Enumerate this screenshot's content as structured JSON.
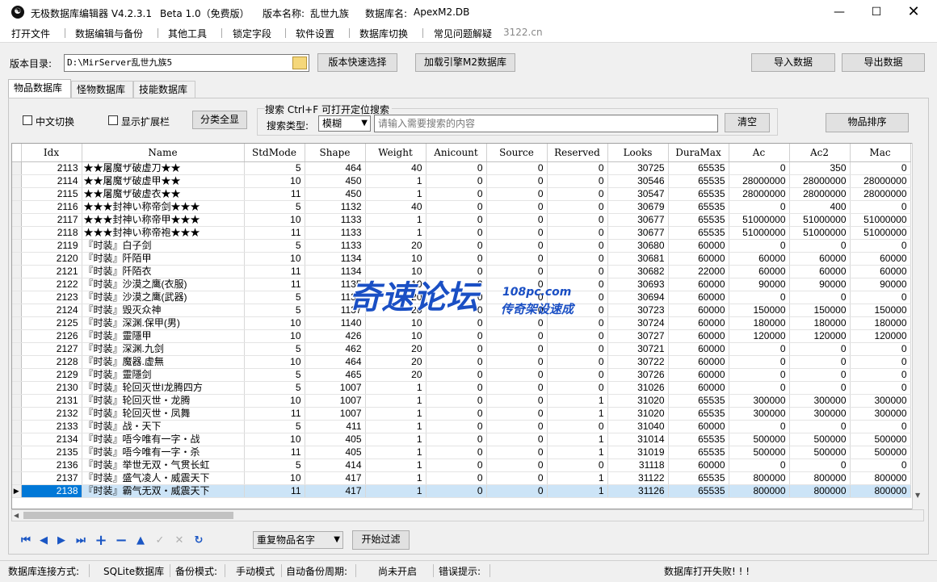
{
  "titlebar": {
    "app_name": "无极数据库编辑器 V4.2.3.1",
    "edition": "Beta 1.0（免费版）",
    "version_label": "版本名称:",
    "version_value": "乱世九族",
    "db_label": "数据库名:",
    "db_value": "ApexM2.DB"
  },
  "menu": [
    "打开文件",
    "数据编辑与备份",
    "其他工具",
    "锁定字段",
    "软件设置",
    "数据库切换",
    "常见问题解疑"
  ],
  "menu_url": "3122.cn",
  "toolbar": {
    "dir_label": "版本目录:",
    "dir_value": "D:\\MirServer乱世九族5",
    "quick_select": "版本快速选择",
    "load_engine": "加载引擎M2数据库",
    "import": "导入数据",
    "export": "导出数据"
  },
  "tabs": [
    "物品数据库",
    "怪物数据库",
    "技能数据库"
  ],
  "filters": {
    "chinese_toggle": "中文切换",
    "show_ext": "显示扩展栏",
    "show_all": "分类全显",
    "search_title": "搜索  Ctrl+F 可打开定位搜索",
    "search_type_label": "搜索类型:",
    "search_type_value": "模糊",
    "search_placeholder": "请输入需要搜索的内容",
    "clear": "清空",
    "sort": "物品排序"
  },
  "grid": {
    "columns": [
      "Idx",
      "Name",
      "StdMode",
      "Shape",
      "Weight",
      "Anicount",
      "Source",
      "Reserved",
      "Looks",
      "DuraMax",
      "Ac",
      "Ac2",
      "Mac"
    ],
    "selected_row": 25,
    "rows": [
      [
        "2113",
        "★★屠魔ザ破虚刀★★",
        "5",
        "464",
        "40",
        "0",
        "0",
        "0",
        "30725",
        "65535",
        "0",
        "350",
        "0"
      ],
      [
        "2114",
        "★★屠魔ザ破虚甲★★",
        "10",
        "450",
        "1",
        "0",
        "0",
        "0",
        "30546",
        "65535",
        "28000000",
        "28000000",
        "28000000"
      ],
      [
        "2115",
        "★★屠魔ザ破虚衣★★",
        "11",
        "450",
        "1",
        "0",
        "0",
        "0",
        "30547",
        "65535",
        "28000000",
        "28000000",
        "28000000"
      ],
      [
        "2116",
        "★★★封神い称帝剑★★★",
        "5",
        "1132",
        "40",
        "0",
        "0",
        "0",
        "30679",
        "65535",
        "0",
        "400",
        "0"
      ],
      [
        "2117",
        "★★★封神い称帝甲★★★",
        "10",
        "1133",
        "1",
        "0",
        "0",
        "0",
        "30677",
        "65535",
        "51000000",
        "51000000",
        "51000000"
      ],
      [
        "2118",
        "★★★封神い称帝袍★★★",
        "11",
        "1133",
        "1",
        "0",
        "0",
        "0",
        "30677",
        "65535",
        "51000000",
        "51000000",
        "51000000"
      ],
      [
        "2119",
        "『时装』白子剑",
        "5",
        "1133",
        "20",
        "0",
        "0",
        "0",
        "30680",
        "60000",
        "0",
        "0",
        "0"
      ],
      [
        "2120",
        "『时装』阡陌甲",
        "10",
        "1134",
        "10",
        "0",
        "0",
        "0",
        "30681",
        "60000",
        "60000",
        "60000",
        "60000"
      ],
      [
        "2121",
        "『时装』阡陌衣",
        "11",
        "1134",
        "10",
        "0",
        "0",
        "0",
        "30682",
        "22000",
        "60000",
        "60000",
        "60000"
      ],
      [
        "2122",
        "『时装』沙漠之鹰(衣服)",
        "11",
        "1135",
        "10",
        "0",
        "0",
        "0",
        "30693",
        "60000",
        "90000",
        "90000",
        "90000"
      ],
      [
        "2123",
        "『时装』沙漠之鹰(武器)",
        "5",
        "1136",
        "20",
        "0",
        "0",
        "0",
        "30694",
        "60000",
        "0",
        "0",
        "0"
      ],
      [
        "2124",
        "『时装』毁灭众神",
        "5",
        "1137",
        "20",
        "0",
        "0",
        "0",
        "30723",
        "60000",
        "150000",
        "150000",
        "150000"
      ],
      [
        "2125",
        "『时装』深渊.保甲(男)",
        "10",
        "1140",
        "10",
        "0",
        "0",
        "0",
        "30724",
        "60000",
        "180000",
        "180000",
        "180000"
      ],
      [
        "2126",
        "『时装』靈隱甲",
        "10",
        "426",
        "10",
        "0",
        "0",
        "0",
        "30727",
        "60000",
        "120000",
        "120000",
        "120000"
      ],
      [
        "2127",
        "『时装』深渊.九剑",
        "5",
        "462",
        "20",
        "0",
        "0",
        "0",
        "30721",
        "60000",
        "0",
        "0",
        "0"
      ],
      [
        "2128",
        "『时装』魔器.虚無",
        "10",
        "464",
        "20",
        "0",
        "0",
        "0",
        "30722",
        "60000",
        "0",
        "0",
        "0"
      ],
      [
        "2129",
        "『时装』靈隱剑",
        "5",
        "465",
        "20",
        "0",
        "0",
        "0",
        "30726",
        "60000",
        "0",
        "0",
        "0"
      ],
      [
        "2130",
        "『时装』轮回灭世I龙腾四方",
        "5",
        "1007",
        "1",
        "0",
        "0",
        "0",
        "31026",
        "60000",
        "0",
        "0",
        "0"
      ],
      [
        "2131",
        "『时装』轮回灭世・龙腾",
        "10",
        "1007",
        "1",
        "0",
        "0",
        "1",
        "31020",
        "65535",
        "300000",
        "300000",
        "300000"
      ],
      [
        "2132",
        "『时装』轮回灭世・凤舞",
        "11",
        "1007",
        "1",
        "0",
        "0",
        "1",
        "31020",
        "65535",
        "300000",
        "300000",
        "300000"
      ],
      [
        "2133",
        "『时装』战・天下",
        "5",
        "411",
        "1",
        "0",
        "0",
        "0",
        "31040",
        "60000",
        "0",
        "0",
        "0"
      ],
      [
        "2134",
        "『时装』唔今唯有一字・战",
        "10",
        "405",
        "1",
        "0",
        "0",
        "1",
        "31014",
        "65535",
        "500000",
        "500000",
        "500000"
      ],
      [
        "2135",
        "『时装』唔今唯有一字・杀",
        "11",
        "405",
        "1",
        "0",
        "0",
        "1",
        "31019",
        "65535",
        "500000",
        "500000",
        "500000"
      ],
      [
        "2136",
        "『时装』举世无双・气贯长虹",
        "5",
        "414",
        "1",
        "0",
        "0",
        "0",
        "31118",
        "60000",
        "0",
        "0",
        "0"
      ],
      [
        "2137",
        "『时装』盛气凌人・威震天下",
        "10",
        "417",
        "1",
        "0",
        "0",
        "1",
        "31122",
        "65535",
        "800000",
        "800000",
        "800000"
      ],
      [
        "2138",
        "『时装』霸气无双・威震天下",
        "11",
        "417",
        "1",
        "0",
        "0",
        "1",
        "31126",
        "65535",
        "800000",
        "800000",
        "800000"
      ]
    ]
  },
  "bottom": {
    "nav_icons": [
      "first-icon",
      "prev-icon",
      "next-icon",
      "last-icon",
      "add-icon",
      "remove-icon",
      "up-icon",
      "confirm-icon",
      "cancel-icon",
      "refresh-icon"
    ],
    "filter_select": "重复物品名字",
    "filter_button": "开始过滤"
  },
  "status": {
    "conn_label": "数据库连接方式:",
    "conn_value": "SQLite数据库",
    "backup_label": "备份模式:",
    "backup_value": "手动模式",
    "auto_label": "自动备份周期:",
    "auto_value": "尚未开启",
    "error_label": "错误提示:",
    "error_value": "数据库打开失败! ! !"
  },
  "watermark": {
    "main": "奇速论坛",
    "domain": "108pc.com",
    "sub": "传奇架设速成"
  }
}
